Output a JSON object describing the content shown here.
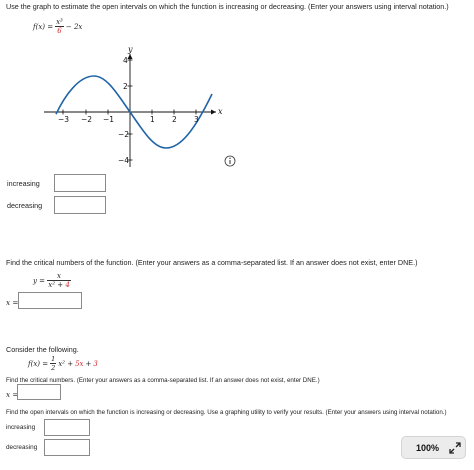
{
  "q1": {
    "instruction": "Use the graph to estimate the open intervals on which the function is increasing or decreasing. (Enter your answers using interval notation.)",
    "fx_lhs": "f(x) =",
    "fx_num": "x³",
    "fx_den": "6",
    "fx_rest": "− 2x",
    "graph": {
      "y_axis_label": "y",
      "x_axis_label": "x",
      "x_ticks": [
        "−3",
        "−2",
        "−1",
        "1",
        "2",
        "3"
      ],
      "y_ticks": [
        "4",
        "2",
        "−2",
        "−4"
      ]
    },
    "increasing_label": "increasing",
    "decreasing_label": "decreasing",
    "increasing_value": "",
    "decreasing_value": ""
  },
  "q2": {
    "instruction": "Find the critical numbers of the function. (Enter your answers as a comma-separated list. If an answer does not exist, enter DNE.)",
    "y_lhs": "y =",
    "num": "x",
    "den_a": "x² + ",
    "den_b": "4",
    "x_label": "x =",
    "x_value": ""
  },
  "q3": {
    "consider": "Consider the following.",
    "fx_lhs": "f(x) =",
    "frac_num": "1",
    "frac_den": "2",
    "fx_mid": "x² + ",
    "fx_red1": "5x",
    "fx_plus": " + ",
    "fx_red2": "3",
    "crit_instruction": "Find the critical numbers. (Enter your answers as a comma-separated list. If an answer does not exist, enter DNE.)",
    "x_label": "x =",
    "x_value": "",
    "open_instruction": "Find the open intervals on which the function is increasing or decreasing. Use a graphing utility to verify your results. (Enter your answers using interval notation.)",
    "increasing_label": "increasing",
    "decreasing_label": "decreasing"
  },
  "zoom": {
    "level": "100%"
  },
  "colors": {
    "curve": "#1f64a8",
    "accent_red": "#d0282e",
    "axis": "#111111"
  }
}
